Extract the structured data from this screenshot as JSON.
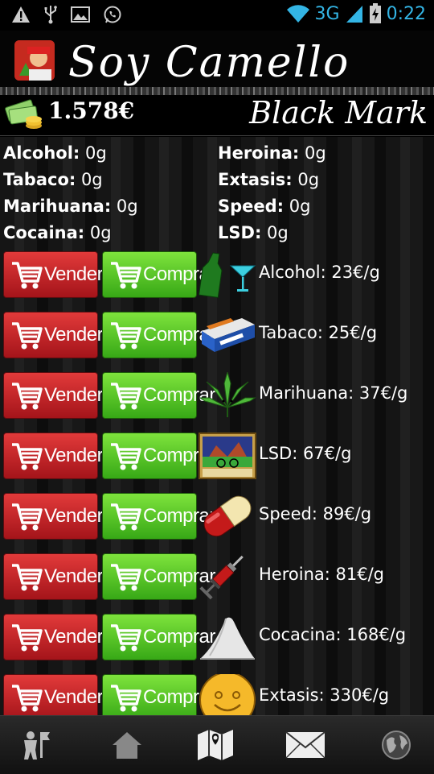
{
  "status_bar": {
    "network": "3G",
    "time": "0:22",
    "notification_icons": [
      "warning-icon",
      "usb-icon",
      "image-icon",
      "whatsapp-icon"
    ]
  },
  "app": {
    "title": "Soy Camello",
    "money": "1.578€",
    "market_label": "Black Mark"
  },
  "inventory": [
    {
      "name": "Alcohol:",
      "amount": " 0g"
    },
    {
      "name": "Heroina:",
      "amount": " 0g"
    },
    {
      "name": "Tabaco:",
      "amount": " 0g"
    },
    {
      "name": "Extasis:",
      "amount": " 0g"
    },
    {
      "name": "Marihuana:",
      "amount": " 0g"
    },
    {
      "name": "Speed:",
      "amount": " 0g"
    },
    {
      "name": "Cocaina:",
      "amount": " 0g"
    },
    {
      "name": "LSD:",
      "amount": " 0g"
    }
  ],
  "buttons": {
    "sell": "Vender",
    "buy": "Comprar"
  },
  "products": [
    {
      "price_label": "Alcohol: 23€/g",
      "icon": "bottle-icon"
    },
    {
      "price_label": "Tabaco: 25€/g",
      "icon": "cigarette-pack-icon"
    },
    {
      "price_label": "Marihuana: 37€/g",
      "icon": "cannabis-leaf-icon"
    },
    {
      "price_label": "LSD: 67€/g",
      "icon": "lsd-stamp-icon"
    },
    {
      "price_label": "Speed: 89€/g",
      "icon": "pill-capsule-icon"
    },
    {
      "price_label": "Heroina: 81€/g",
      "icon": "syringe-icon"
    },
    {
      "price_label": "Cocacina: 168€/g",
      "icon": "powder-pile-icon"
    },
    {
      "price_label": "Extasis: 330€/g",
      "icon": "smiley-pill-icon"
    }
  ],
  "nav": [
    "character-icon",
    "home-icon",
    "map-icon",
    "mail-icon",
    "globe-icon"
  ]
}
